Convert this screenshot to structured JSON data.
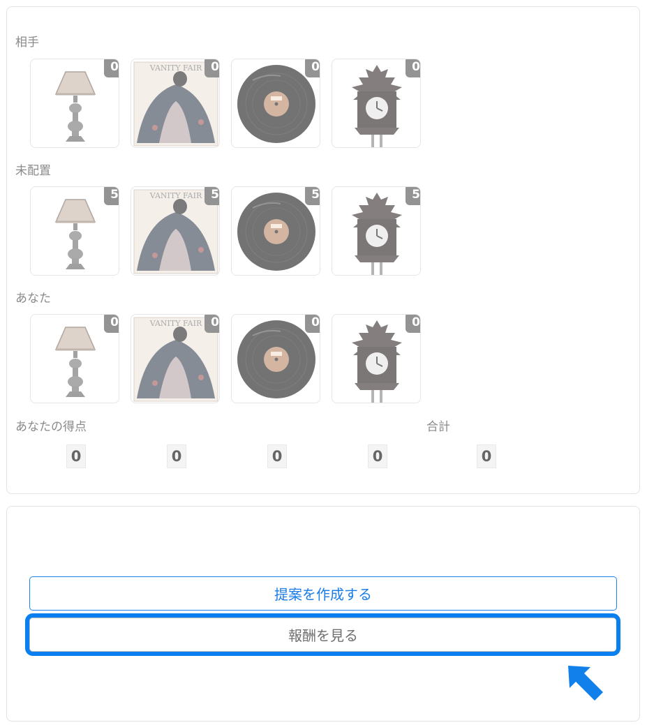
{
  "sections": [
    {
      "label": "相手",
      "counts": [
        "0",
        "0",
        "0",
        "0"
      ]
    },
    {
      "label": "未配置",
      "counts": [
        "5",
        "5",
        "5",
        "5"
      ]
    },
    {
      "label": "あなた",
      "counts": [
        "0",
        "0",
        "0",
        "0"
      ]
    }
  ],
  "items": [
    {
      "name": "lamp",
      "icon": "table-lamp-icon"
    },
    {
      "name": "poster",
      "icon": "vanity-fair-poster-icon",
      "poster_text": "VANITY FAIR"
    },
    {
      "name": "record",
      "icon": "vinyl-record-icon"
    },
    {
      "name": "clock",
      "icon": "cuckoo-clock-icon"
    }
  ],
  "score": {
    "label": "あなたの得点",
    "total_label": "合計",
    "values": [
      "0",
      "0",
      "0",
      "0"
    ],
    "total": "0"
  },
  "actions": {
    "create_offer": "提案を作成する",
    "view_rewards": "報酬を見る"
  },
  "colors": {
    "accent": "#1a83f0",
    "highlight": "#0a7ff0",
    "badge": "#939393"
  }
}
